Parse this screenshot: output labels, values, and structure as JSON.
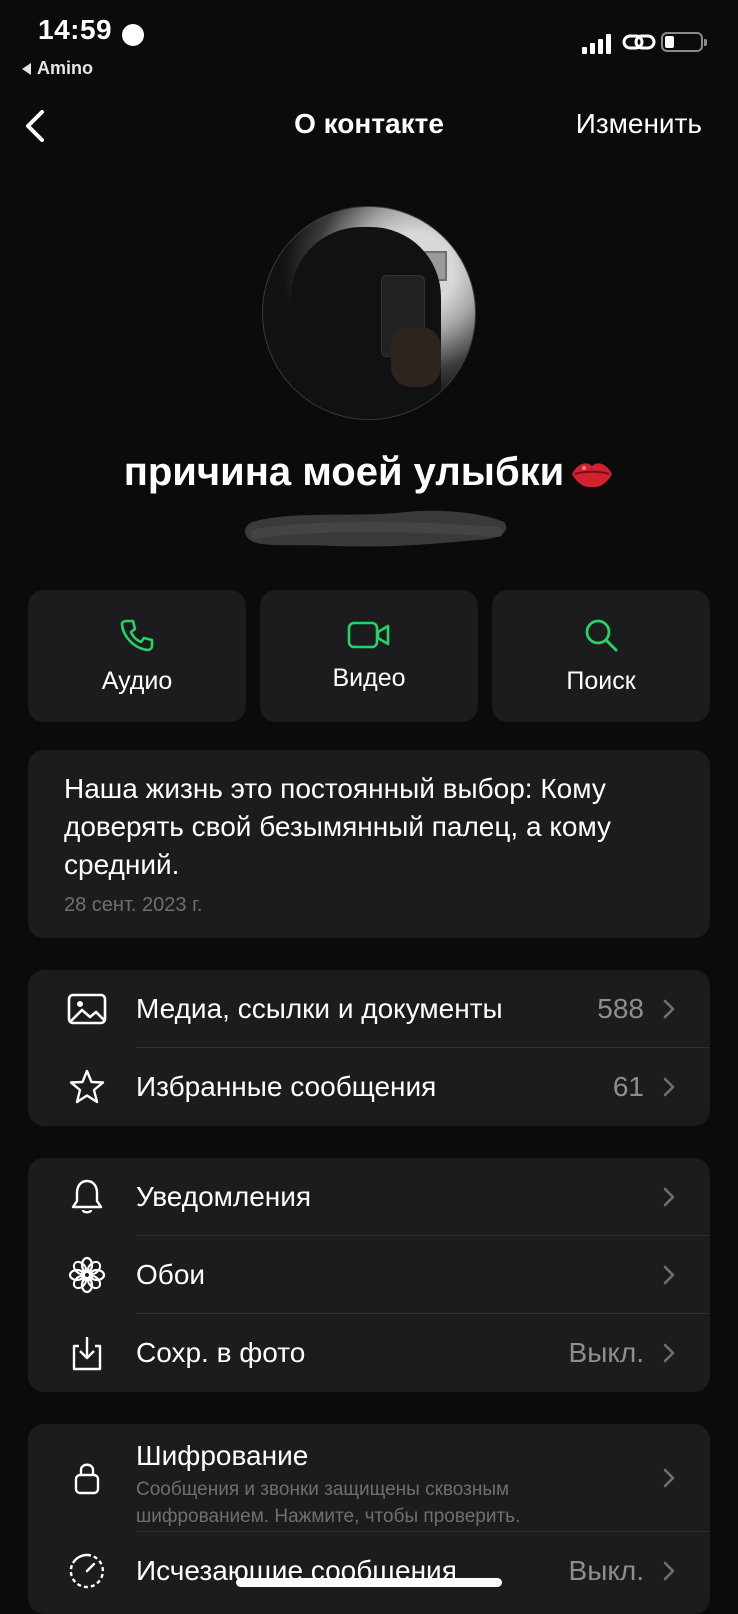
{
  "status_bar": {
    "time": "14:59",
    "back_app": "Amino"
  },
  "nav": {
    "title": "О контакте",
    "edit": "Изменить"
  },
  "contact": {
    "name": "причина моей улыбки"
  },
  "actions": [
    {
      "label": "Аудио",
      "icon": "phone-icon"
    },
    {
      "label": "Видео",
      "icon": "video-icon"
    },
    {
      "label": "Поиск",
      "icon": "search-icon"
    }
  ],
  "about": {
    "text": "Наша жизнь это постоянный выбор: Кому доверять свой безымянный палец, а кому средний.",
    "date": "28 сент. 2023 г."
  },
  "group1": [
    {
      "label": "Медиа, ссылки и документы",
      "value": "588",
      "icon": "image-icon"
    },
    {
      "label": "Избранные сообщения",
      "value": "61",
      "icon": "star-icon"
    }
  ],
  "group2": [
    {
      "label": "Уведомления",
      "value": "",
      "icon": "bell-icon"
    },
    {
      "label": "Обои",
      "value": "",
      "icon": "flower-icon"
    },
    {
      "label": "Сохр. в фото",
      "value": "Выкл.",
      "icon": "save-download-icon"
    }
  ],
  "group3": {
    "encryption": {
      "label": "Шифрование",
      "sub": "Сообщения и звонки защищены сквозным шифрованием. Нажмите, чтобы проверить.",
      "icon": "lock-icon"
    },
    "disappearing": {
      "label": "Исчезающие сообщения",
      "value": "Выкл.",
      "icon": "timer-icon"
    }
  },
  "colors": {
    "accent": "#25d366",
    "card": "#1c1c1e",
    "background": "#0b0b0c",
    "secondary_text": "#8d8d92"
  }
}
